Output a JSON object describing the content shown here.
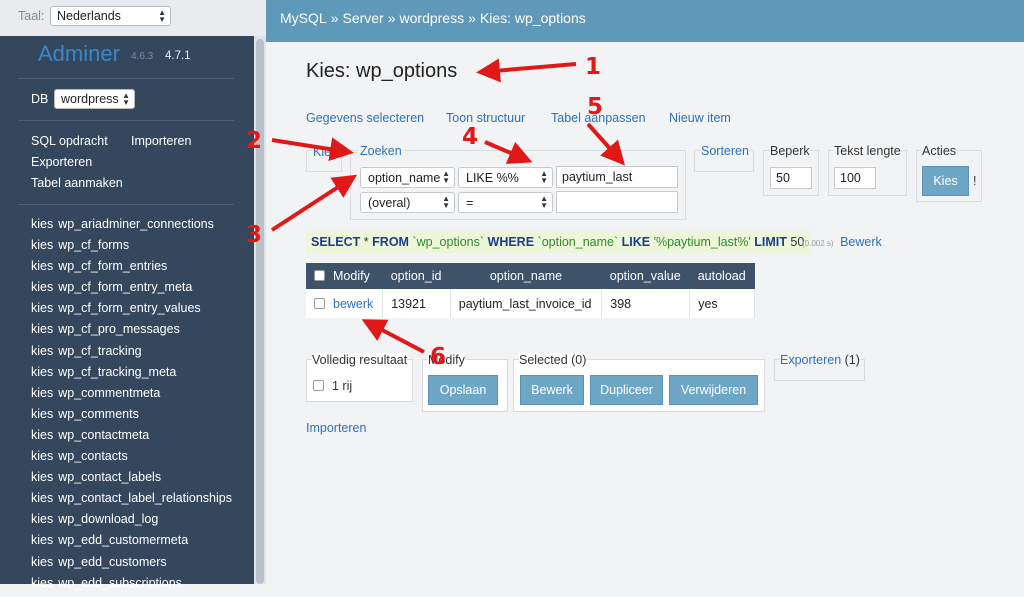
{
  "sidebar": {
    "lang_label": "Taal:",
    "lang_value": "Nederlands",
    "logo": "Adminer",
    "version_old": "4.6.3",
    "version_new": "4.7.1",
    "db_label": "DB",
    "db_value": "wordpress",
    "actions": [
      "SQL opdracht",
      "Importeren",
      "Exporteren",
      "Tabel aanmaken"
    ],
    "kies": "kies",
    "tables": [
      "wp_ariadminer_connections",
      "wp_cf_forms",
      "wp_cf_form_entries",
      "wp_cf_form_entry_meta",
      "wp_cf_form_entry_values",
      "wp_cf_pro_messages",
      "wp_cf_tracking",
      "wp_cf_tracking_meta",
      "wp_commentmeta",
      "wp_comments",
      "wp_contactmeta",
      "wp_contacts",
      "wp_contact_labels",
      "wp_contact_label_relationships",
      "wp_download_log",
      "wp_edd_customermeta",
      "wp_edd_customers",
      "wp_edd_subscriptions"
    ]
  },
  "breadcrumb": [
    "MySQL",
    "Server",
    "wordpress",
    "Kies: wp_options"
  ],
  "breadcrumb_sep": "»",
  "page_title": "Kies: wp_options",
  "tabs": [
    "Gegevens selecteren",
    "Toon structuur",
    "Tabel aanpassen",
    "Nieuw item"
  ],
  "search": {
    "kies_label": "Kies",
    "legend": "Zoeken",
    "column_value": "option_name",
    "operator_value": "LIKE %%",
    "text_value": "paytium_last",
    "column2_value": "(overal)",
    "operator2_value": "=",
    "text2_value": ""
  },
  "sort_label": "Sorteren",
  "limit": {
    "label": "Beperk",
    "value": "50"
  },
  "text_length": {
    "label": "Tekst lengte",
    "value": "100"
  },
  "actions": {
    "label": "Acties",
    "button": "Kies",
    "extra": "!"
  },
  "sql": {
    "select": "SELECT",
    "star": "*",
    "from": "FROM",
    "table": "`wp_options`",
    "where": "WHERE",
    "column": "`option_name`",
    "like": "LIKE",
    "pattern": "'%paytium_last%'",
    "limit_kw": "LIMIT",
    "limit_val": "50",
    "time": "(0.002 s)",
    "edit": "Bewerk"
  },
  "table": {
    "headers": [
      "Modify",
      "option_id",
      "option_name",
      "option_value",
      "autoload"
    ],
    "rows": [
      {
        "edit": "bewerk",
        "option_id": "13921",
        "option_name": "paytium_last_invoice_id",
        "option_value": "398",
        "autoload": "yes"
      }
    ]
  },
  "full_result": {
    "label": "Volledig resultaat",
    "rows": "1 rij"
  },
  "modify": {
    "label": "Modify",
    "button": "Opslaan"
  },
  "selected": {
    "label": "Selected (0)",
    "buttons": [
      "Bewerk",
      "Dupliceer",
      "Verwijderen"
    ]
  },
  "export": {
    "link": "Exporteren",
    "count": "(1)"
  },
  "import_link": "Importeren",
  "annotation_numbers": [
    "1",
    "2",
    "3",
    "4",
    "5",
    "6"
  ],
  "annotation_color": "#e01818"
}
